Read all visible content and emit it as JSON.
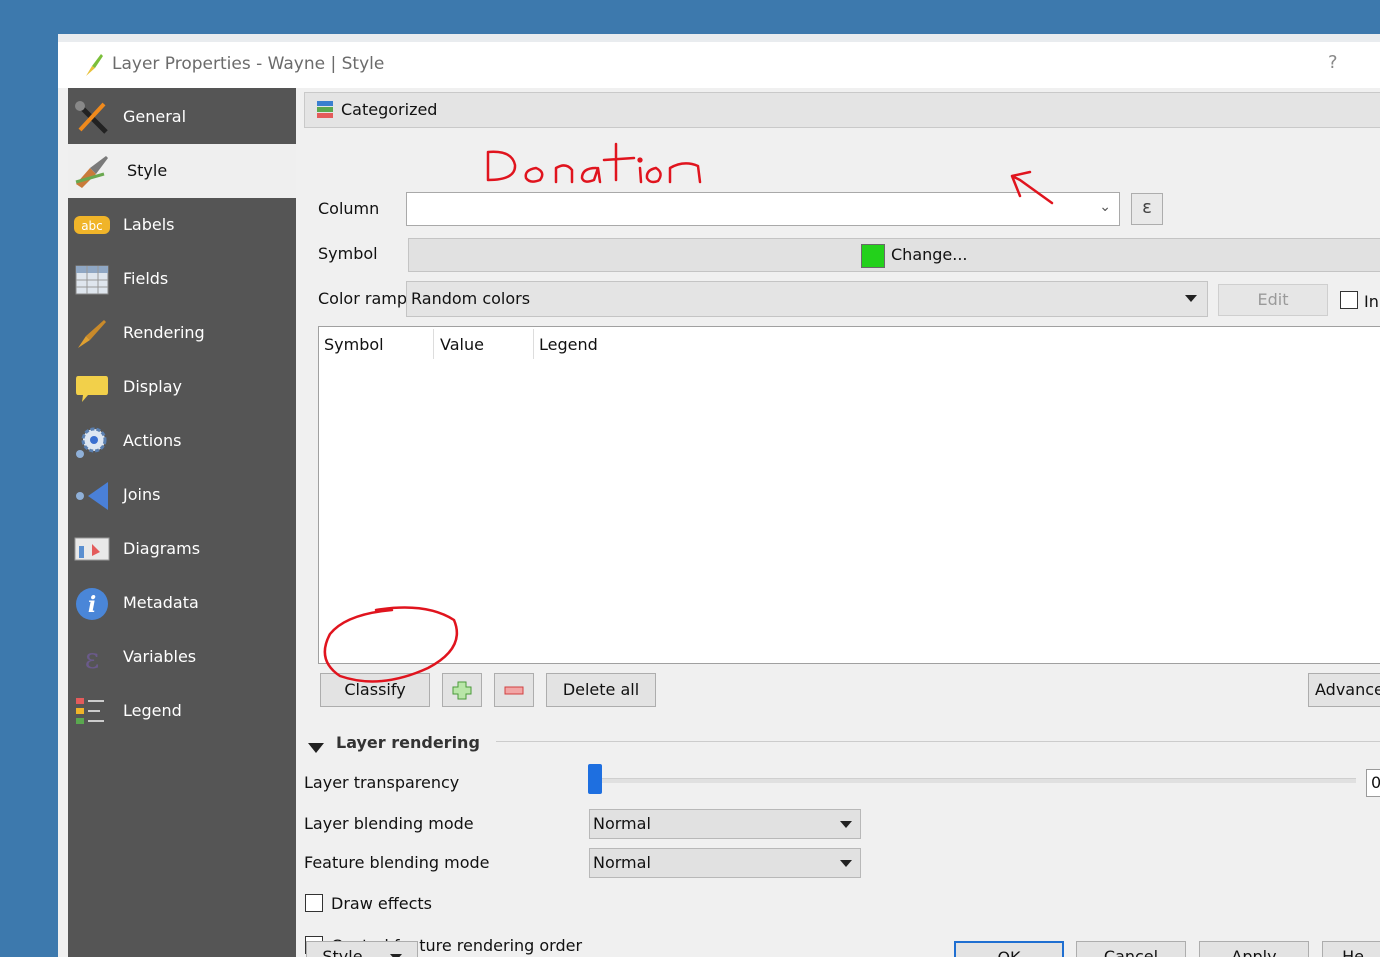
{
  "window": {
    "title": "Layer Properties - Wayne | Style",
    "help_label": "?"
  },
  "sidebar": {
    "items": [
      {
        "label": "General",
        "icon": "wrench-screwdriver-icon"
      },
      {
        "label": "Style",
        "icon": "paintbrush-icon",
        "active": true
      },
      {
        "label": "Labels",
        "icon": "abc-label-icon"
      },
      {
        "label": "Fields",
        "icon": "table-icon"
      },
      {
        "label": "Rendering",
        "icon": "brush-icon"
      },
      {
        "label": "Display",
        "icon": "speech-bubble-icon"
      },
      {
        "label": "Actions",
        "icon": "gear-actions-icon"
      },
      {
        "label": "Joins",
        "icon": "join-arrow-icon"
      },
      {
        "label": "Diagrams",
        "icon": "diagram-icon"
      },
      {
        "label": "Metadata",
        "icon": "info-icon"
      },
      {
        "label": "Variables",
        "icon": "epsilon-icon"
      },
      {
        "label": "Legend",
        "icon": "legend-icon"
      }
    ]
  },
  "style": {
    "renderer": "Categorized",
    "column_label": "Column",
    "column_value": "",
    "expression_label": "ε",
    "symbol_label": "Symbol",
    "symbol_change": "Change...",
    "symbol_color": "#23d11b",
    "color_ramp_label": "Color ramp",
    "color_ramp_value": "Random colors",
    "edit_label": "Edit",
    "invert_label": "In",
    "table_headers": [
      "Symbol",
      "Value",
      "Legend"
    ],
    "classify_label": "Classify",
    "delete_all_label": "Delete all",
    "advanced_label": "Advance"
  },
  "layer_rendering": {
    "header": "Layer rendering",
    "transparency_label": "Layer transparency",
    "transparency_value": "0",
    "blending_label": "Layer blending mode",
    "blending_value": "Normal",
    "feature_blending_label": "Feature blending mode",
    "feature_blending_value": "Normal",
    "draw_effects_label": "Draw effects",
    "control_order_label": "Control feature rendering order"
  },
  "footer": {
    "style_label": "Style",
    "ok_label": "OK",
    "cancel_label": "Cancel",
    "apply_label": "Apply",
    "help_label": "He"
  },
  "annotation": {
    "handwritten_text": "Donation",
    "color": "#e0141e"
  }
}
